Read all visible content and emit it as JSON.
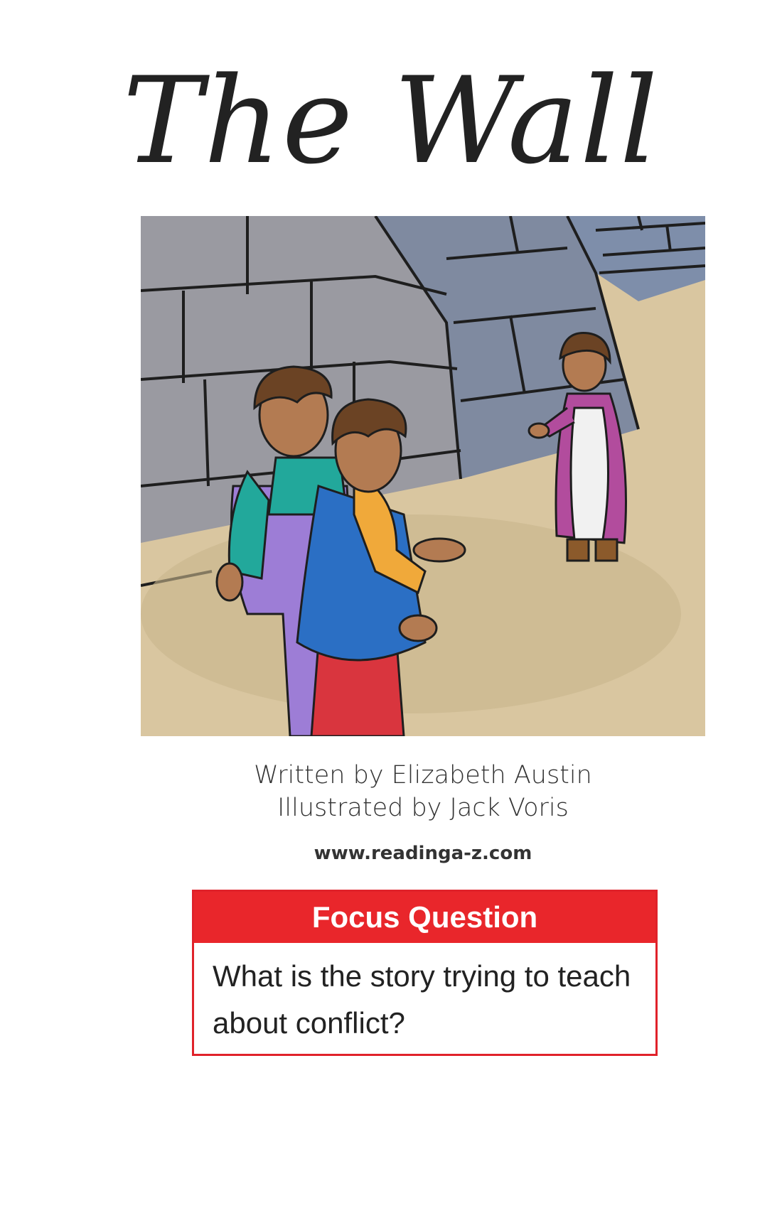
{
  "book": {
    "title": "The Wall",
    "written_by": "Written by Elizabeth Austin",
    "illustrated_by": "Illustrated by Jack Voris",
    "website": "www.readinga-z.com"
  },
  "focus": {
    "header": "Focus Question",
    "question": "What is the story trying to teach about conflict?"
  },
  "colors": {
    "accent_red": "#e9262b",
    "wall_gray": "#8f8f96",
    "ground_sand": "#d9c6a0"
  }
}
